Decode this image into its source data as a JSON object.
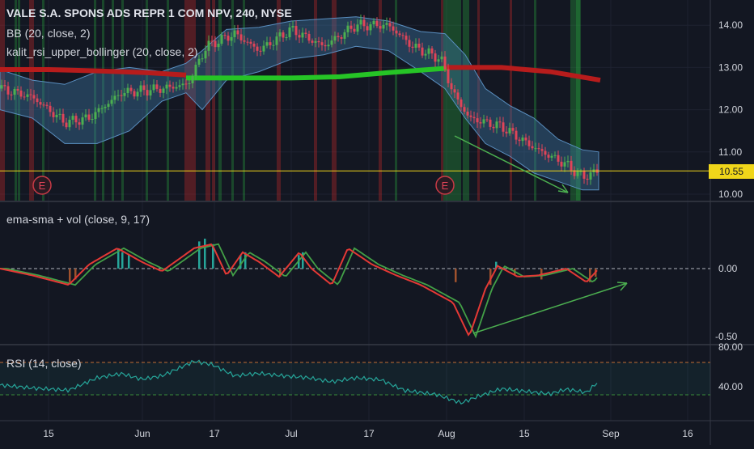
{
  "header": {
    "title": "VALE S.A. SPONS ADS REPR 1 COM NPV, 240, NYSE",
    "bb_label": "BB (20, close, 2)",
    "kalit_label": "kalit_rsi_upper_bollinger (20, close, 2)",
    "ema_label": "ema-sma + vol (close, 9, 17)",
    "rsi_label": "RSI (14, close)"
  },
  "last_price": {
    "label": "10.55",
    "value": 10.55
  },
  "earnings_marker": {
    "label": "E",
    "dates": [
      "May 8",
      "Jul 31"
    ]
  },
  "colors": {
    "background": "#131722",
    "up_candle": "#4caf50",
    "down_candle": "#e04458",
    "bb_fill": "#3a6f9a",
    "green_line": "#26c426",
    "red_line": "#b71c1c",
    "last_price": "#f0d61a",
    "ema_line": "#e53935",
    "sma_line": "#43a047",
    "vol_up": "#26a69a",
    "vol_down": "#a0522d",
    "rsi_line": "#26a69a",
    "trendline": "#4caf50"
  },
  "chart_data": [
    {
      "type": "candlestick",
      "x": [
        "May 8",
        "May 15",
        "May 22",
        "Jun 1",
        "Jun 8",
        "Jun 17",
        "Jun 24",
        "Jul 1",
        "Jul 8",
        "Jul 17",
        "Jul 24",
        "Aug 1",
        "Aug 8",
        "Aug 15",
        "Aug 22",
        "Aug 28"
      ],
      "close": [
        12.6,
        11.7,
        12.1,
        12.7,
        12.6,
        13.2,
        13.6,
        13.5,
        13.9,
        14.0,
        13.4,
        12.3,
        11.5,
        11.2,
        10.6,
        10.55
      ],
      "y_ticks": [
        10.0,
        11.0,
        12.0,
        13.0,
        14.0
      ],
      "y_tick_labels": [
        "10.00",
        "11.00",
        "12.00",
        "13.00",
        "14.00"
      ],
      "ylim": [
        9.85,
        14.45
      ],
      "overlays": [
        "BB (20, close, 2)",
        "kalit_rsi_upper_bollinger (20, close, 2)"
      ]
    },
    {
      "type": "line",
      "name": "ema-sma + vol (close, 9, 17)",
      "y_tick_labels": [
        "0.00",
        "-0.50"
      ],
      "ylim": [
        -0.55,
        0.3
      ],
      "x": [
        "May 8",
        "May 15",
        "May 22",
        "Jun 1",
        "Jun 8",
        "Jun 17",
        "Jun 24",
        "Jul 1",
        "Jul 8",
        "Jul 17",
        "Jul 24",
        "Aug 1",
        "Aug 8",
        "Aug 15",
        "Aug 22",
        "Aug 28"
      ],
      "values": [
        -0.05,
        -0.15,
        0.1,
        0.05,
        -0.05,
        0.2,
        -0.15,
        0.1,
        -0.1,
        0.15,
        -0.05,
        -0.2,
        -0.3,
        -0.15,
        -0.1,
        0.0
      ]
    },
    {
      "type": "line",
      "name": "RSI (14, close)",
      "y_tick_labels": [
        "80.00",
        "40.00"
      ],
      "ylim": [
        20,
        82
      ],
      "x": [
        "May 8",
        "May 15",
        "May 22",
        "Jun 1",
        "Jun 8",
        "Jun 17",
        "Jun 24",
        "Jul 1",
        "Jul 8",
        "Jul 17",
        "Jul 24",
        "Aug 1",
        "Aug 8",
        "Aug 15",
        "Aug 22",
        "Aug 28"
      ],
      "values": [
        42,
        38,
        55,
        60,
        52,
        70,
        58,
        62,
        55,
        60,
        45,
        30,
        40,
        42,
        38,
        55
      ]
    }
  ],
  "x_axis": {
    "labels": [
      "15",
      "Jun",
      "17",
      "Jul",
      "17",
      "Aug",
      "15",
      "Sep",
      "16"
    ]
  }
}
